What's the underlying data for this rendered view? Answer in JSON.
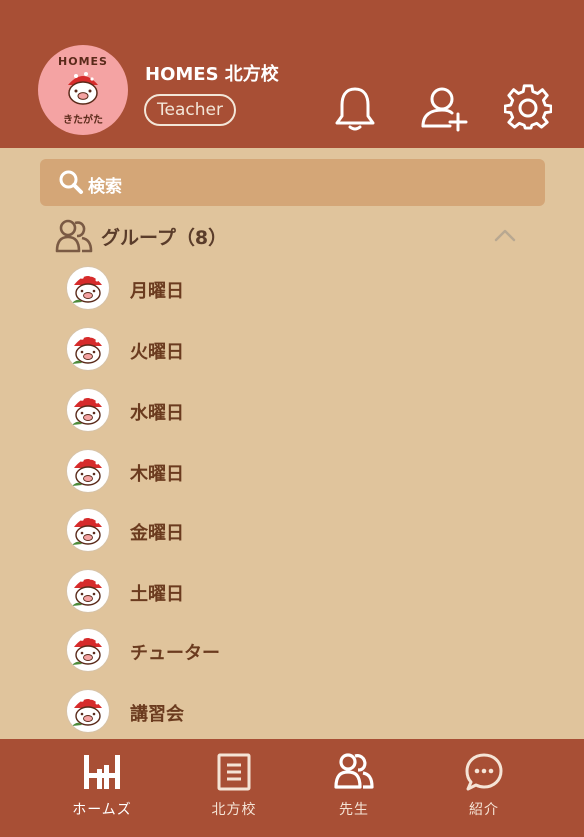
{
  "header": {
    "logo_text_top": "HOMES",
    "logo_text_bottom": "きたがた",
    "school_name": "HOMES 北方校",
    "role_badge": "Teacher",
    "icons": [
      "bell-icon",
      "add-user-icon",
      "gear-icon"
    ]
  },
  "search": {
    "label": "検索"
  },
  "group": {
    "title": "グループ（8）",
    "items": [
      {
        "label": "月曜日"
      },
      {
        "label": "火曜日"
      },
      {
        "label": "水曜日"
      },
      {
        "label": "木曜日"
      },
      {
        "label": "金曜日"
      },
      {
        "label": "土曜日"
      },
      {
        "label": "チューター"
      },
      {
        "label": "講習会"
      }
    ]
  },
  "bottom_nav": {
    "items": [
      {
        "label": "ホームズ",
        "icon": "home-logo-icon",
        "active": true
      },
      {
        "label": "北方校",
        "icon": "document-icon",
        "active": false
      },
      {
        "label": "先生",
        "icon": "users-icon",
        "active": false
      },
      {
        "label": "紹介",
        "icon": "chat-bubble-icon",
        "active": false
      }
    ]
  },
  "colors": {
    "header_bg": "#a84f35",
    "body_bg": "#e0c49c",
    "search_bg": "#d4a677",
    "label_text": "#6b3b1f"
  }
}
